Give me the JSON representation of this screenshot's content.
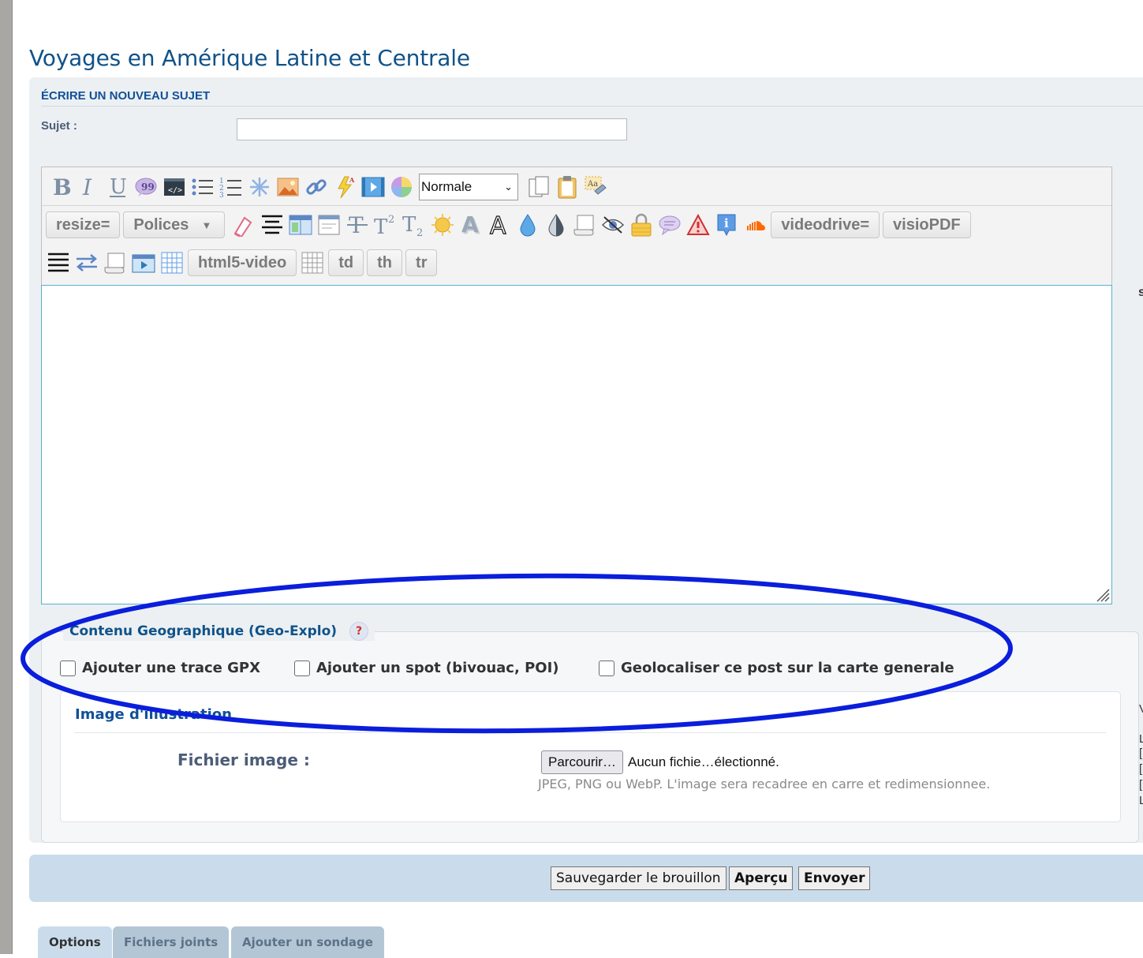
{
  "page_title": "Voyages en Amérique Latine et Centrale",
  "form": {
    "heading": "ÉCRIRE UN NOUVEAU SUJET",
    "subject_label": "Sujet :",
    "subject_value": ""
  },
  "toolbar": {
    "row1_icons": [
      "bold-icon",
      "italic-icon",
      "underline-icon",
      "quote-icon",
      "code-icon",
      "bullet-list-icon",
      "numbered-list-icon",
      "list-item-icon",
      "image-icon",
      "link-icon",
      "flash-icon",
      "video-icon",
      "color-icon"
    ],
    "font_size_select": "Normale",
    "row1_extra_icons": [
      "copy-icon",
      "paste-icon",
      "spellcheck-icon"
    ],
    "resize_label": "resize=",
    "polices_label": "Polices",
    "videodrive_label": "videodrive=",
    "visiopdf_label": "visioPDF",
    "html5video_label": "html5-video",
    "td_label": "td",
    "th_label": "th",
    "tr_label": "tr"
  },
  "side_fragment": "s",
  "geo": {
    "legend": "Contenu Geographique (Geo-Explo)",
    "help": "?",
    "options": [
      {
        "label": "Ajouter une trace GPX",
        "checked": false
      },
      {
        "label": "Ajouter un spot (bivouac, POI)",
        "checked": false
      },
      {
        "label": "Geolocaliser ce post sur la carte generale",
        "checked": false
      }
    ]
  },
  "illustration": {
    "title": "Image d'illustration",
    "file_label": "Fichier image :",
    "browse_label": "Parcourir…",
    "no_file": "Aucun fichie…électionné.",
    "hint": "JPEG, PNG ou WebP. L'image sera recadree en carre et redimensionnee."
  },
  "right_fragments": [
    "V",
    "L",
    "[",
    "[",
    "[",
    "L"
  ],
  "actions": {
    "save_draft": "Sauvegarder le brouillon",
    "preview": "Aperçu",
    "submit": "Envoyer"
  },
  "tabs": [
    {
      "label": "Options",
      "active": true
    },
    {
      "label": "Fichiers joints",
      "active": false
    },
    {
      "label": "Ajouter un sondage",
      "active": false
    }
  ],
  "colors": {
    "title_blue": "#105289",
    "panel_bg": "#ecf0f3",
    "submit_bar_bg": "#cadceb",
    "annotation_ellipse": "#0a1edc"
  }
}
